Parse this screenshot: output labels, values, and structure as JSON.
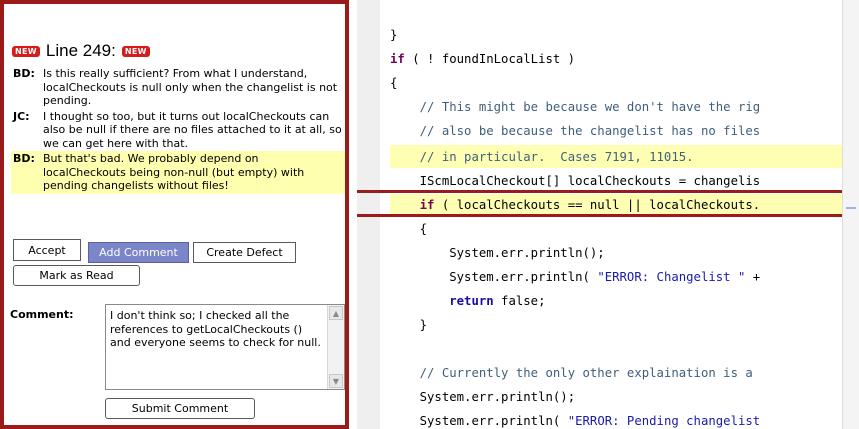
{
  "review": {
    "new_badge": "NEW",
    "line_title": "Line 249:",
    "messages": [
      {
        "author": "BD:",
        "text": "Is this really sufficient? From what I understand, localCheckouts is null only when the changelist is not pending.",
        "highlighted": false
      },
      {
        "author": "JC:",
        "text": "I thought so too, but it turns out localCheckouts can also be null if there are no files attached to it at all, so we can get here with that.",
        "highlighted": false
      },
      {
        "author": "BD:",
        "text": "But that's bad. We probably depend on localCheckouts being non-null (but empty) with pending changelists without files!",
        "highlighted": true
      }
    ],
    "buttons": {
      "accept": "Accept",
      "add_comment": "Add Comment",
      "create_defect": "Create Defect",
      "mark_as_read": "Mark as Read",
      "submit_comment": "Submit Comment"
    },
    "comment_label": "Comment:",
    "comment_value": "I don't think so; I checked all the references to getLocalCheckouts () and everyone seems to check for null."
  },
  "code": {
    "lines": [
      {
        "text": "}"
      },
      {
        "kw": "if",
        "text": " ( ! foundInLocalList )"
      },
      {
        "text": "{"
      },
      {
        "indent": "    ",
        "comment": "// This might be because we don't have the rig"
      },
      {
        "indent": "    ",
        "comment": "// also be because the changelist has no files"
      },
      {
        "indent": "    ",
        "comment": "// in particular.  Cases 7191, 11015."
      },
      {
        "indent": "    ",
        "text": "IScmLocalCheckout[] localCheckouts = changelis"
      },
      {
        "indent": "    ",
        "kw": "if",
        "text": " ( localCheckouts == null || localCheckouts."
      },
      {
        "indent": "    ",
        "text": "{"
      },
      {
        "indent": "        ",
        "text": "System.err.println();"
      },
      {
        "indent": "        ",
        "text": "System.err.println( ",
        "string": "\"ERROR: Changelist \"",
        "tail": " +"
      },
      {
        "indent": "        ",
        "kw": "return",
        "text": " false;",
        "kw_style": "blue"
      },
      {
        "indent": "    ",
        "text": "}"
      },
      {
        "text": ""
      },
      {
        "indent": "    ",
        "comment": "// Currently the only other explaination is a"
      },
      {
        "indent": "    ",
        "text": "System.err.println();"
      },
      {
        "indent": "    ",
        "text": "System.err.println( ",
        "string": "\"ERROR: Pending changelist"
      }
    ]
  },
  "colors": {
    "panel_border": "#9b1b1b",
    "badge": "#d81a1a",
    "highlight": "#ffffb0",
    "accent_button": "#7a86c8",
    "keyword": "#7a0055",
    "comment": "#3f5f7f",
    "string": "#1a1ab0"
  }
}
